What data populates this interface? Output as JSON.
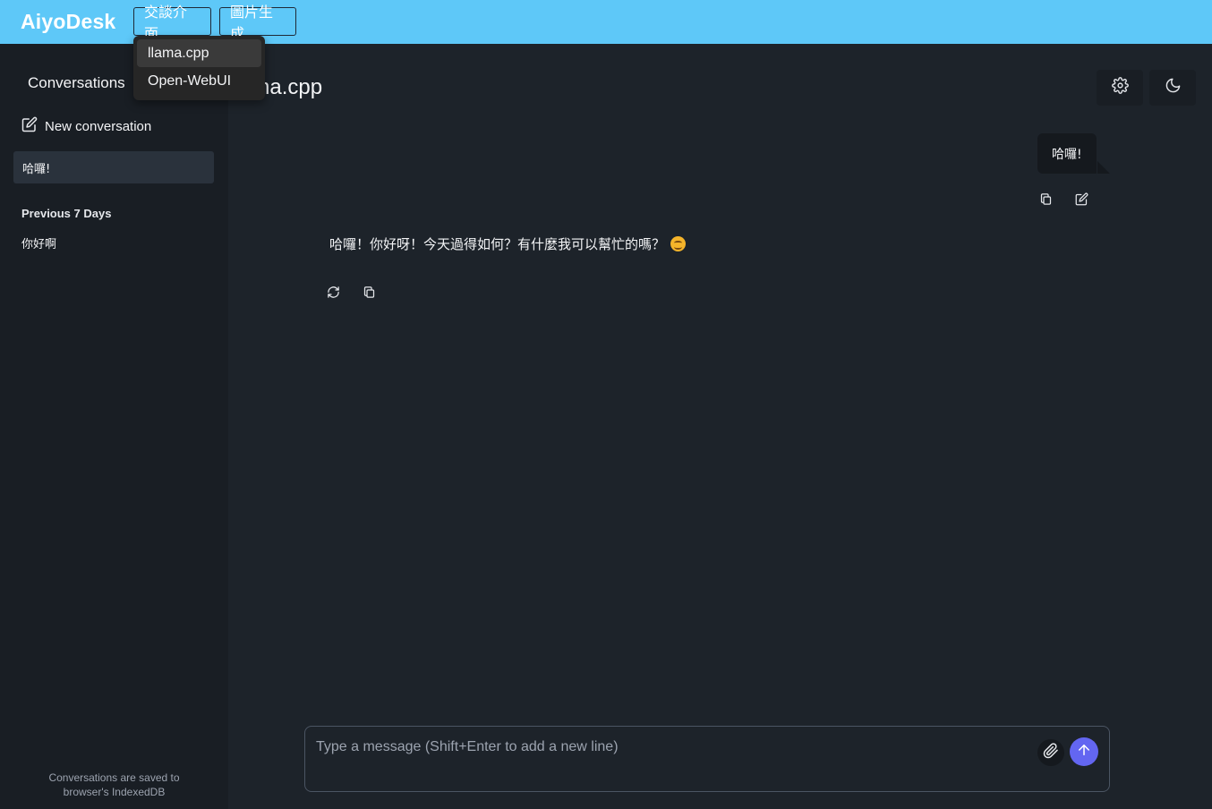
{
  "header": {
    "brand": "AiyoDesk",
    "nav": {
      "chat_label": "交談介面",
      "image_label": "圖片生成"
    },
    "dropdown": {
      "items": [
        "llama.cpp",
        "Open-WebUI"
      ],
      "selected": "llama.cpp"
    }
  },
  "sidebar": {
    "title": "Conversations",
    "new_conversation_label": "New conversation",
    "active_conversation": "哈囉!",
    "section_label": "Previous 7 Days",
    "conversations": [
      "你好啊"
    ],
    "footer_line1": "Conversations are saved to",
    "footer_line2": "browser's IndexedDB"
  },
  "main": {
    "title": "llama.cpp",
    "title_visible": "ama.cpp",
    "user_message": "哈囉!",
    "assistant_message": "哈囉！你好呀！今天過得如何？有什麼我可以幫忙的嗎？"
  },
  "composer": {
    "placeholder": "Type a message (Shift+Enter to add a new line)"
  },
  "icons": [
    "gear-icon",
    "moon-icon",
    "edit-icon",
    "copy-icon",
    "refresh-icon",
    "paperclip-icon",
    "arrow-up-icon",
    "smile-emoji-icon"
  ],
  "colors": {
    "header_bg": "#5ec8f8",
    "sidebar_bg": "#191e24",
    "main_bg": "#1d232a",
    "send_button": "#6366f1"
  }
}
